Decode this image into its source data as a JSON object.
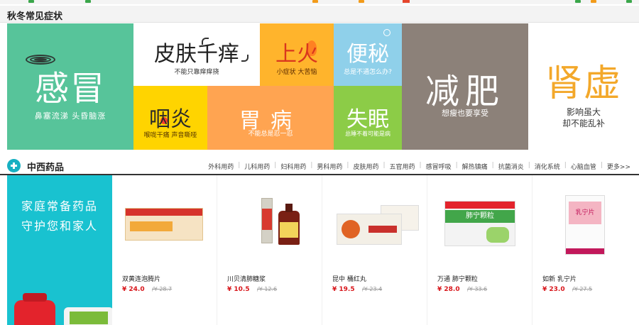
{
  "section": {
    "title": "秋冬常见症状"
  },
  "tiles": {
    "cold": {
      "title": "感冒",
      "sub": "鼻塞流涕 头昏脑涨"
    },
    "skin": {
      "title": "皮肤千痒",
      "sub": "不能只靠痒痒挠"
    },
    "fire": {
      "title": "上火",
      "sub": "小症状 大苦恼"
    },
    "const": {
      "title": "便秘",
      "sub": "总是不通怎么办?"
    },
    "fat": {
      "title": "减肥",
      "sub": "想瘦也要享受"
    },
    "kidney": {
      "title": "肾虚",
      "sub1": "影响虽大",
      "sub2": "却不能乱补"
    },
    "throat": {
      "title": "咽炎",
      "sub": "喉咙干痛 声音嘶哑"
    },
    "stomach": {
      "title": "胃病",
      "sub": "不能总是忍一忍"
    },
    "sleep": {
      "title": "失眠",
      "sub": "总睡不着可能是病"
    }
  },
  "category": {
    "title": "中西药品",
    "links": [
      "外科用药",
      "儿科用药",
      "妇科用药",
      "男科用药",
      "皮肤用药",
      "五官用药",
      "感冒呼吸",
      "解热镇痛",
      "抗菌消炎",
      "消化系统",
      "心脑血管",
      "更多>>"
    ]
  },
  "banner": {
    "line1": "家庭常备药品",
    "line2": "守护您和家人"
  },
  "products": [
    {
      "name": "双黄连泡腾片",
      "price": "¥ 24.0",
      "old": "/¥ 28.7"
    },
    {
      "name": "川贝清肺糖浆",
      "price": "¥ 10.5",
      "old": "/¥ 12.6"
    },
    {
      "name": "昆中 桶红丸",
      "price": "¥ 19.5",
      "old": "/¥ 23.4"
    },
    {
      "name": "万通 肺宁颗粒",
      "price": "¥ 28.0",
      "old": "/¥ 33.6"
    },
    {
      "name": "如新 乳宁片",
      "price": "¥ 23.0",
      "old": "/¥ 27.5"
    }
  ],
  "product_images": {
    "box4_label": "肺宁颗粒",
    "box5_label": "乳宁片"
  },
  "colors": {
    "cold": "#57c49a",
    "fire": "#ffb42c",
    "constipation": "#8fd0ea",
    "fat": "#8c8179",
    "throat": "#ffd400",
    "stomach": "#ffa451",
    "sleep": "#8ccc47",
    "kidney_text": "#f3a82a",
    "banner": "#19c2d0",
    "price": "#d8161b",
    "category_icon": "#17b0c2"
  }
}
